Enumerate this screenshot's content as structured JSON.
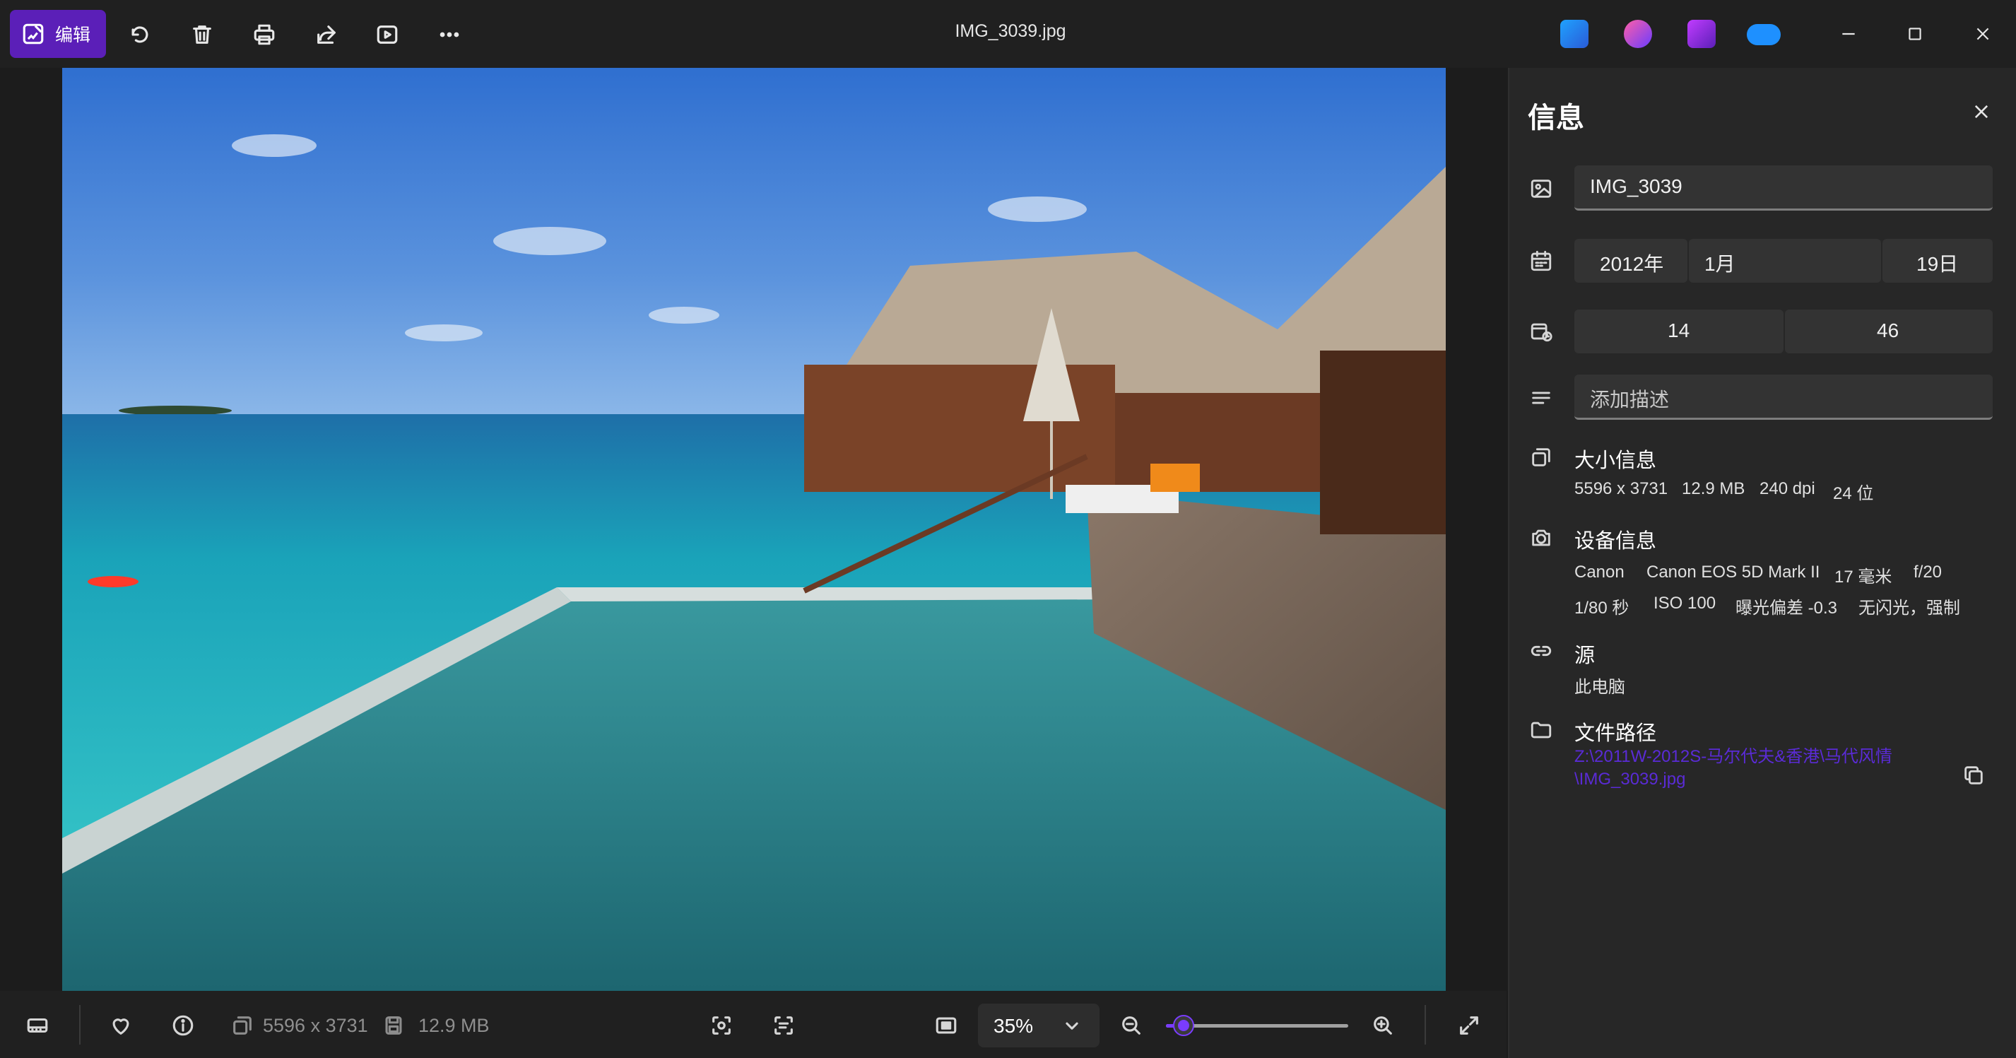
{
  "window": {
    "title": "IMG_3039.jpg"
  },
  "toolbar": {
    "edit_label": "编辑"
  },
  "bottom_bar": {
    "dimensions": "5596 x 3731",
    "file_size": "12.9 MB",
    "zoom": "35%",
    "zoom_slider_fraction": 0.06
  },
  "info": {
    "title": "信息",
    "file_name": "IMG_3039",
    "date": {
      "year": "2012年",
      "month": "1月",
      "day": "19日"
    },
    "time": {
      "hour": "14",
      "minute": "46"
    },
    "description_placeholder": "添加描述",
    "size_section": {
      "title": "大小信息",
      "values": [
        "5596 x 3731",
        "12.9 MB",
        "240 dpi",
        "24 位"
      ]
    },
    "device_section": {
      "title": "设备信息",
      "row1": [
        "Canon",
        "Canon EOS 5D Mark II",
        "17 毫米",
        "f/20"
      ],
      "row2": [
        "1/80 秒",
        "ISO 100",
        "曝光偏差 -0.3",
        "无闪光，强制"
      ]
    },
    "source_section": {
      "title": "源",
      "value": "此电脑"
    },
    "path_section": {
      "title": "文件路径",
      "line1": "Z:\\2011W-2012S-马尔代夫&香港\\马代风情",
      "line2": "\\IMG_3039.jpg"
    }
  },
  "colors": {
    "accent": "#5b1fb8",
    "slider_accent": "#7a3cff",
    "link": "#5a2bd6"
  }
}
